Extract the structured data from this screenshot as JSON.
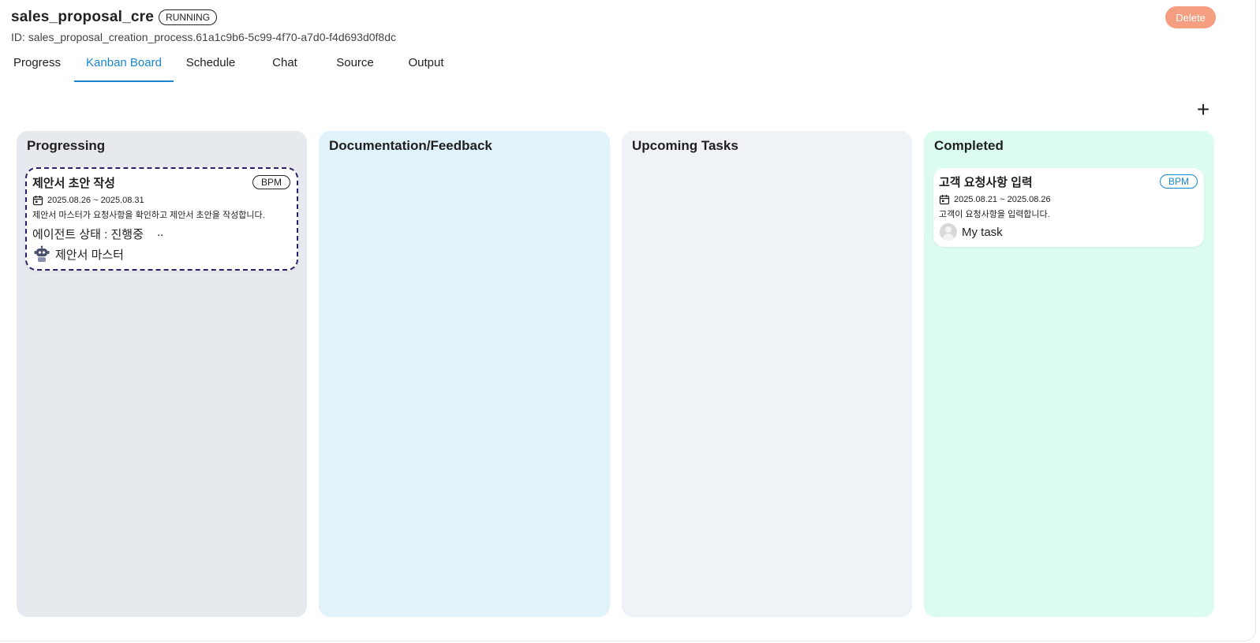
{
  "header": {
    "title": "sales_proposal_cre",
    "status": "RUNNING",
    "id_text": "ID: sales_proposal_creation_process.61a1c9b6-5c99-4f70-a7d0-f4d693d0f8dc",
    "delete_label": "Delete"
  },
  "tabs": [
    {
      "label": "Progress"
    },
    {
      "label": "Kanban Board"
    },
    {
      "label": "Schedule"
    },
    {
      "label": "Chat"
    },
    {
      "label": "Source"
    },
    {
      "label": "Output"
    }
  ],
  "active_tab": "Kanban Board",
  "add_label": "+",
  "columns": [
    {
      "title": "Progressing",
      "color": "#e6eaef",
      "cards": [
        {
          "title": "제안서 초안 작성",
          "badge": "BPM",
          "date": "2025.08.26 ~ 2025.08.31",
          "description": "제안서 마스터가 요청사항을 확인하고 제안서 초안을 작성합니다.",
          "agent_status": "에이전트 상태 : 진행중",
          "dots": "..",
          "assignee": "제안서 마스터",
          "assignee_icon": "robot-icon"
        }
      ]
    },
    {
      "title": "Documentation/Feedback",
      "color": "#e0f3fa",
      "cards": []
    },
    {
      "title": "Upcoming Tasks",
      "color": "#eff3f8",
      "cards": []
    },
    {
      "title": "Completed",
      "color": "#dcfcef",
      "cards": [
        {
          "title": "고객 요청사항 입력",
          "badge": "BPM",
          "date": "2025.08.21 ~ 2025.08.26",
          "description": "고객이 요청사항을 입력합니다.",
          "assignee": "My task",
          "assignee_icon": "avatar-icon"
        }
      ]
    }
  ],
  "colors": {
    "accent": "#1a86d0",
    "delete": "#f59e80",
    "selected_border": "#2d1f6b"
  }
}
